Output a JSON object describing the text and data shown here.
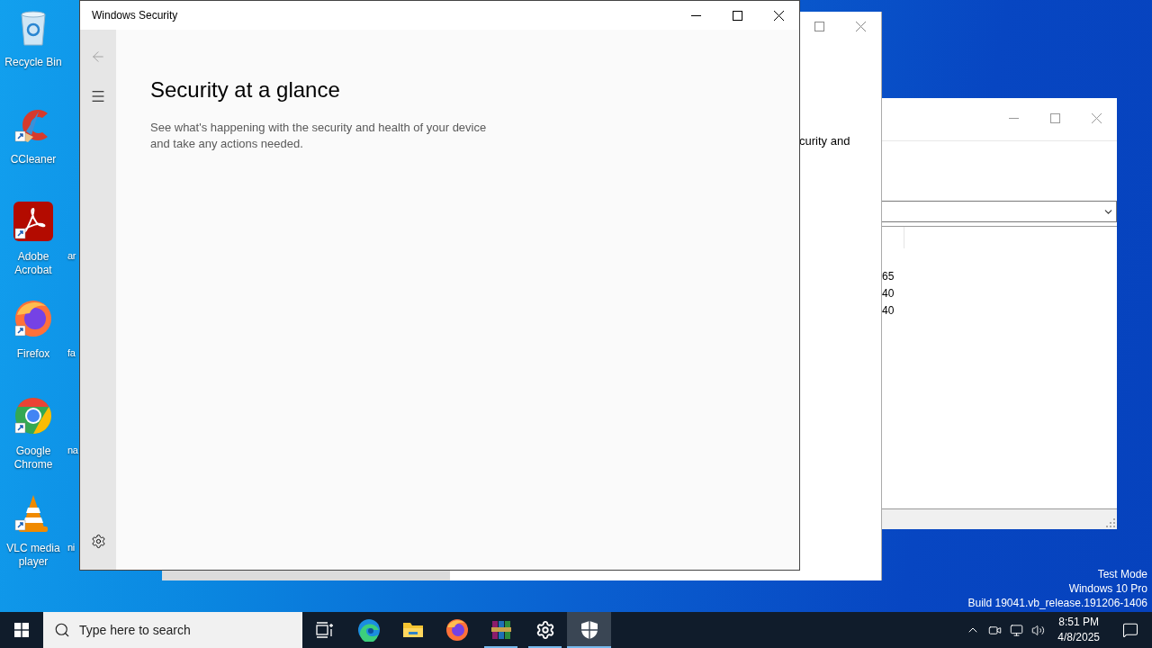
{
  "desktop": {
    "icons": [
      {
        "kind": "recycle-bin",
        "label": "Recycle Bin",
        "shortcut": false
      },
      {
        "kind": "ccleaner",
        "label": "CCleaner",
        "shortcut": true
      },
      {
        "kind": "acrobat",
        "label": "Adobe Acrobat",
        "shortcut": true
      },
      {
        "kind": "firefox",
        "label": "Firefox",
        "shortcut": true
      },
      {
        "kind": "chrome",
        "label": "Google Chrome",
        "shortcut": true
      },
      {
        "kind": "vlc",
        "label": "VLC media player",
        "shortcut": true
      }
    ],
    "column_2_labels": [
      "ar",
      "fa",
      "na",
      "ni"
    ],
    "system_notice": [
      "Test Mode",
      "Windows 10 Pro",
      "Build 19041.vb_release.191206-1406"
    ]
  },
  "background_window": {
    "text": "curity and"
  },
  "list_window": {
    "rows": [
      "65",
      "40",
      "40"
    ]
  },
  "security_window": {
    "title": "Windows Security",
    "back_button": {
      "disabled": true
    },
    "heading": "Security at a glance",
    "description": "See what's happening with the security and health of your device and take any actions needed."
  },
  "taskbar": {
    "search": {
      "placeholder": "Type here to search"
    },
    "apps": [
      {
        "kind": "task-view",
        "running": false,
        "selected": false
      },
      {
        "kind": "edge",
        "running": false,
        "selected": false
      },
      {
        "kind": "explorer",
        "running": false,
        "selected": false
      },
      {
        "kind": "firefox",
        "running": false,
        "selected": false
      },
      {
        "kind": "winrar",
        "running": true,
        "selected": false
      },
      {
        "kind": "settings",
        "running": true,
        "selected": false
      },
      {
        "kind": "security",
        "running": true,
        "selected": true
      }
    ],
    "tray": {
      "time": "8:51 PM",
      "date": "4/8/2025"
    }
  }
}
